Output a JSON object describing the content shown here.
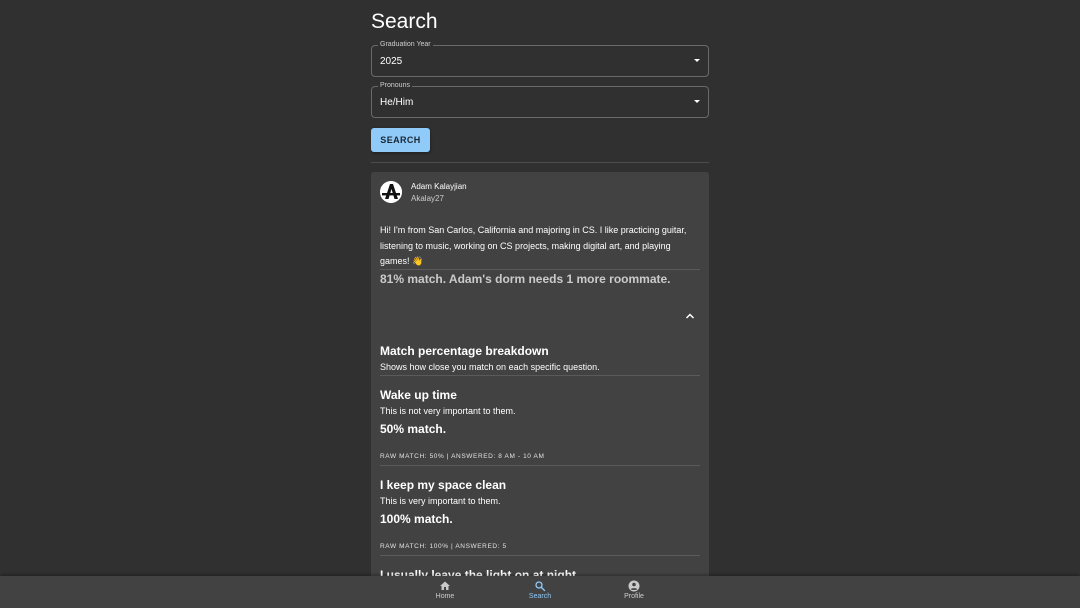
{
  "page": {
    "title": "Search"
  },
  "filters": {
    "graduation_year": {
      "label": "Graduation Year",
      "value": "2025"
    },
    "pronouns": {
      "label": "Pronouns",
      "value": "He/Him"
    },
    "search_label": "SEARCH"
  },
  "result": {
    "name": "Adam Kalayjian",
    "handle": "Akalay27",
    "bio": "Hi! I'm from San Carlos, California and majoring in CS. I like practicing guitar, listening to music, working on CS projects, making digital art, and playing games! 👋",
    "match_summary": "81% match. Adam's dorm needs 1 more roommate.",
    "breakdown": {
      "title": "Match percentage breakdown",
      "subtitle": "Shows how close you match on each specific question."
    },
    "questions": [
      {
        "title": "Wake up time",
        "importance": "This is not very important to them.",
        "match": "50% match.",
        "raw": "RAW MATCH: 50% | ANSWERED: 8 AM - 10 AM"
      },
      {
        "title": "I keep my space clean",
        "importance": "This is very important to them.",
        "match": "100% match.",
        "raw": "RAW MATCH: 100% | ANSWERED: 5"
      },
      {
        "title": "I usually leave the light on at night"
      }
    ]
  },
  "nav": {
    "home": "Home",
    "search": "Search",
    "profile": "Profile"
  },
  "colors": {
    "background": "#303030",
    "card": "#424242",
    "accent": "#90caf9"
  }
}
